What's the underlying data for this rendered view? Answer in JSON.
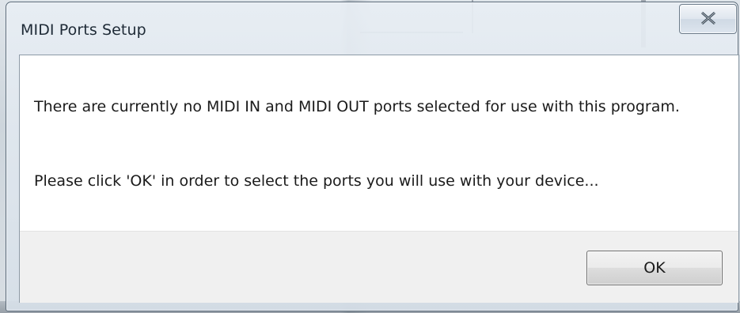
{
  "window": {
    "title": "MIDI Ports Setup",
    "close_icon": "close-icon"
  },
  "message": {
    "line1": "There are currently no MIDI IN and MIDI OUT ports selected for use with this program.",
    "line2": "Please click 'OK' in order to select the ports you will use with your device..."
  },
  "buttons": {
    "ok_label": "OK"
  },
  "colors": {
    "frame_border": "#5b6b7a",
    "client_bg": "#ffffff",
    "footer_bg": "#f0f0f0"
  }
}
